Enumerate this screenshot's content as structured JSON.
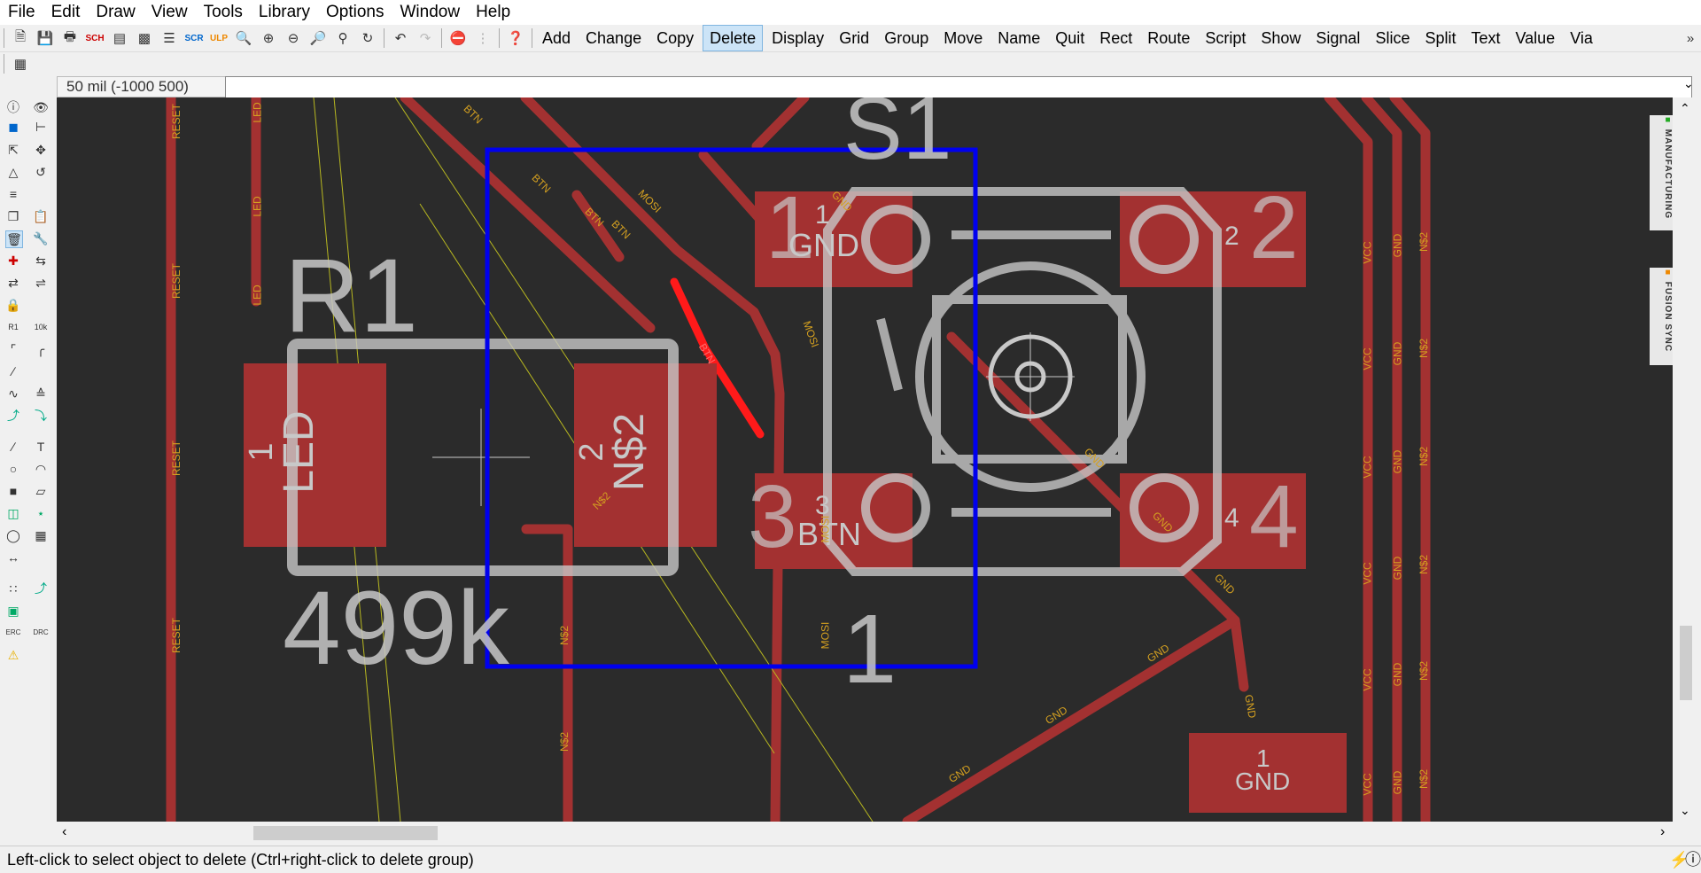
{
  "menu": [
    "File",
    "Edit",
    "Draw",
    "View",
    "Tools",
    "Library",
    "Options",
    "Window",
    "Help"
  ],
  "commands": [
    "Add",
    "Change",
    "Copy",
    "Delete",
    "Display",
    "Grid",
    "Group",
    "Move",
    "Name",
    "Quit",
    "Rect",
    "Route",
    "Script",
    "Show",
    "Signal",
    "Slice",
    "Split",
    "Text",
    "Value",
    "Via"
  ],
  "active_command": "Delete",
  "coord_readout": "50 mil (-1000 500)",
  "command_line_value": "",
  "status_text": "Left-click to select object to delete (Ctrl+right-click to delete group)",
  "side_panels": [
    "MANUFACTURING",
    "FUSION SYNC"
  ],
  "colors": {
    "canvas": "#2b2b2b",
    "trace": "#a33131",
    "selected_trace": "#ff1a1a",
    "silk": "#c8c8c8",
    "pad": "#a33131",
    "selection_box": "#0000ee",
    "net_label": "#d4a020",
    "airwire": "#b8b820"
  },
  "board": {
    "r1_name": "R1",
    "r1_value": "499k",
    "r1_pad1_num": "1",
    "r1_pad1_signal": "LED",
    "r1_pad2_num": "2",
    "r1_pad2_signal": "N$2",
    "s1_name": "S1",
    "s1_pad1_num": "1",
    "s1_pad1_signal": "GND",
    "s1_pad2_num": "2",
    "s1_pad3_num": "3",
    "s1_pad3_signal": "BTN",
    "s1_pad4_num": "4",
    "s1_pad1_big": "1",
    "s1_pad2_big": "2",
    "s1_pad3_big": "3",
    "s1_pad4_big": "4",
    "sw_label": "1",
    "gnd_pad_num": "1",
    "gnd_pad_signal": "GND",
    "net_reset": "RESET",
    "net_led": "LED",
    "net_btn": "BTN",
    "net_mosi": "MOSI",
    "net_gnd": "GND",
    "net_vcc": "VCC",
    "net_n2": "N$2"
  }
}
